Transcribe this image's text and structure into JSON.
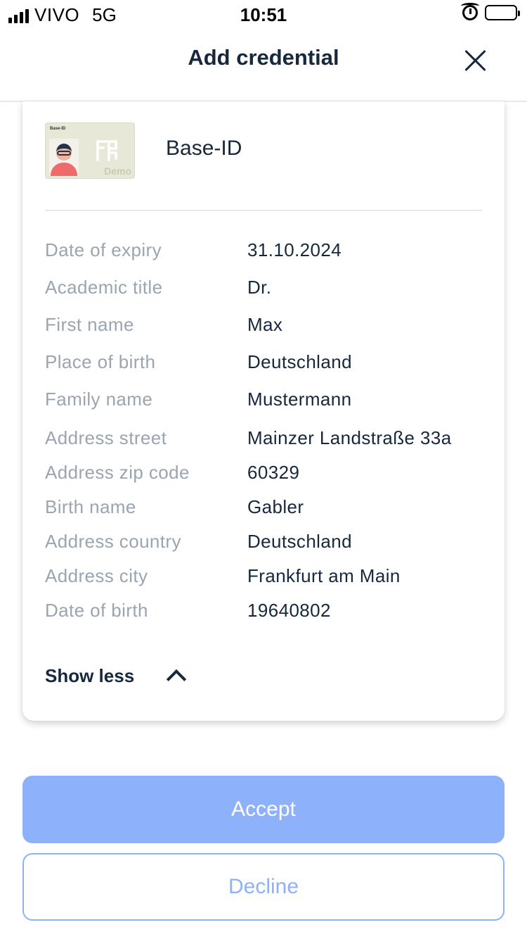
{
  "status_bar": {
    "carrier": "VIVO",
    "network": "5G",
    "time": "10:51"
  },
  "header": {
    "title": "Add credential"
  },
  "card": {
    "thumbnail_label": "Base-ID",
    "thumbnail_watermark": "Demo",
    "title": "Base-ID",
    "attributes": [
      {
        "label": "Date of expiry",
        "value": "31.10.2024"
      },
      {
        "label": "Academic title",
        "value": "Dr."
      },
      {
        "label": "First name",
        "value": "Max"
      },
      {
        "label": "Place of birth",
        "value": "Deutschland"
      },
      {
        "label": "Family name",
        "value": "Mustermann"
      },
      {
        "label": "Address street",
        "value": "Mainzer Landstraße 33a"
      },
      {
        "label": "Address zip code",
        "value": "60329"
      },
      {
        "label": "Birth name",
        "value": "Gabler"
      },
      {
        "label": "Address country",
        "value": "Deutschland"
      },
      {
        "label": "Address city",
        "value": "Frankfurt am Main"
      },
      {
        "label": "Date of birth",
        "value": "19640802"
      }
    ],
    "toggle_label": "Show less"
  },
  "actions": {
    "accept_label": "Accept",
    "decline_label": "Decline"
  },
  "colors": {
    "text_primary": "#16283d",
    "text_muted": "#9aa5b1",
    "accent": "#8db2fb"
  }
}
